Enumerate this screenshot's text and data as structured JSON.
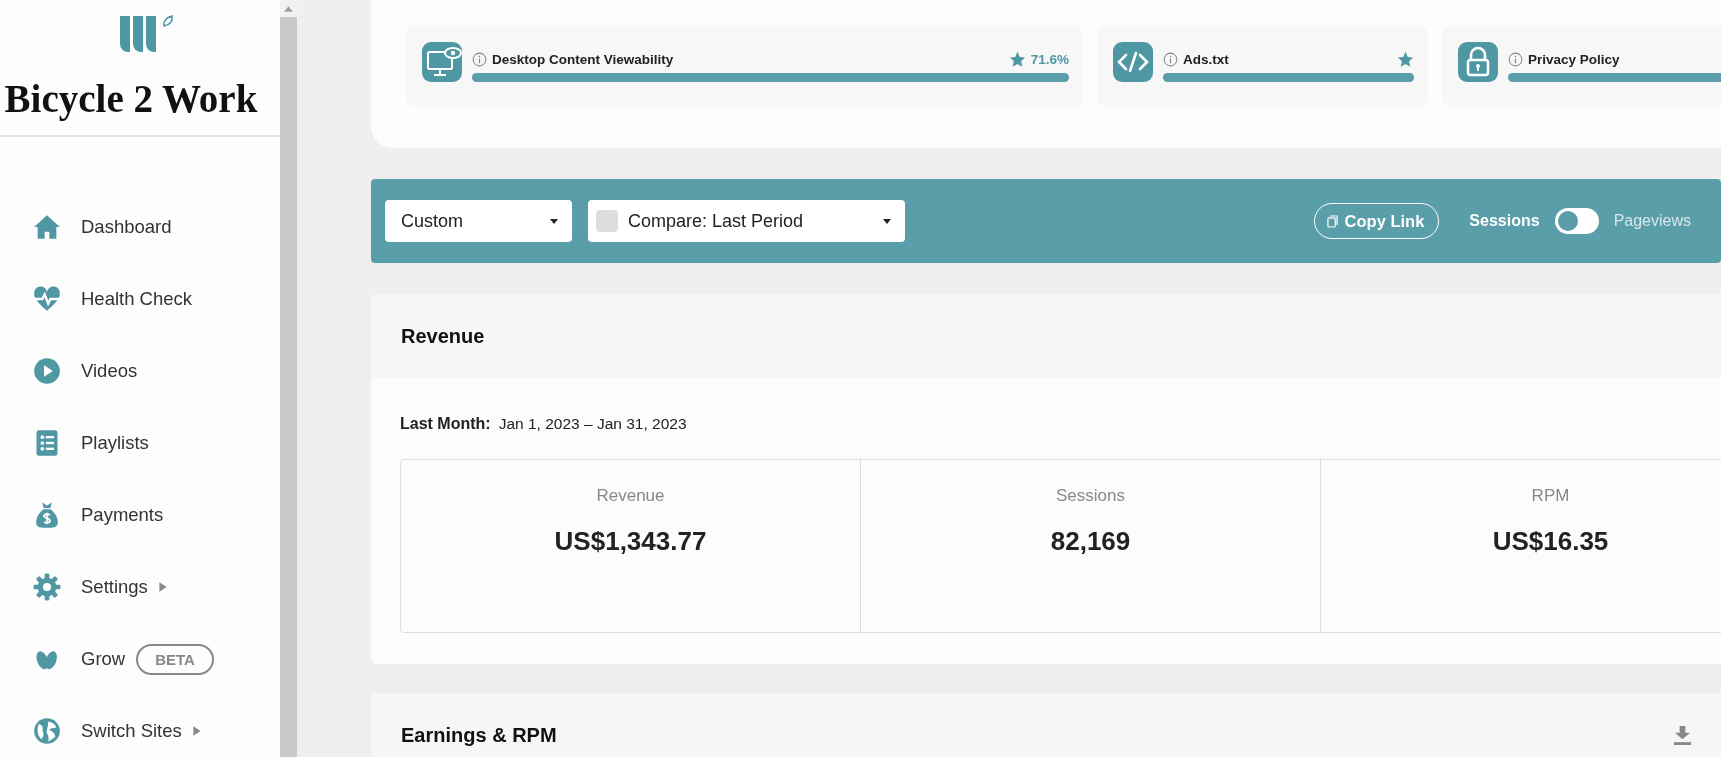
{
  "sidebar": {
    "site_name": "Bicycle 2 Work",
    "nav_items": [
      {
        "label": "Dashboard",
        "has_submenu": false
      },
      {
        "label": "Health Check",
        "has_submenu": false
      },
      {
        "label": "Videos",
        "has_submenu": false
      },
      {
        "label": "Playlists",
        "has_submenu": false
      },
      {
        "label": "Payments",
        "has_submenu": false
      },
      {
        "label": "Settings",
        "has_submenu": true
      },
      {
        "label": "Grow",
        "has_submenu": false,
        "badge": "BETA"
      },
      {
        "label": "Switch Sites",
        "has_submenu": true
      }
    ]
  },
  "health_checks": [
    {
      "label": "Desktop Content Viewability",
      "level": 1,
      "starred": true,
      "reading": "71.6%"
    },
    {
      "label": "Ads.txt",
      "level": 1,
      "starred": true
    },
    {
      "label": "Privacy Policy",
      "level": 1
    }
  ],
  "filters": {
    "date_range": {
      "value": "Custom"
    },
    "compare": {
      "value": "Compare: Last Period",
      "checked": false
    },
    "copy_link": "Copy Link",
    "metric_toggle": [
      {
        "label": "Sessions",
        "selected": true
      },
      {
        "label": "Pageviews",
        "selected": false
      }
    ]
  },
  "revenue": {
    "title": "Revenue",
    "period_label": "Last Month:",
    "period_dates": "Jan 1, 2023 – Jan 31, 2023",
    "stats": [
      {
        "label": "Revenue",
        "value": "US$1,343.77"
      },
      {
        "label": "Sessions",
        "value": "82,169"
      },
      {
        "label": "RPM",
        "value": "US$16.35"
      }
    ]
  },
  "earnings": {
    "title": "Earnings & RPM"
  }
}
